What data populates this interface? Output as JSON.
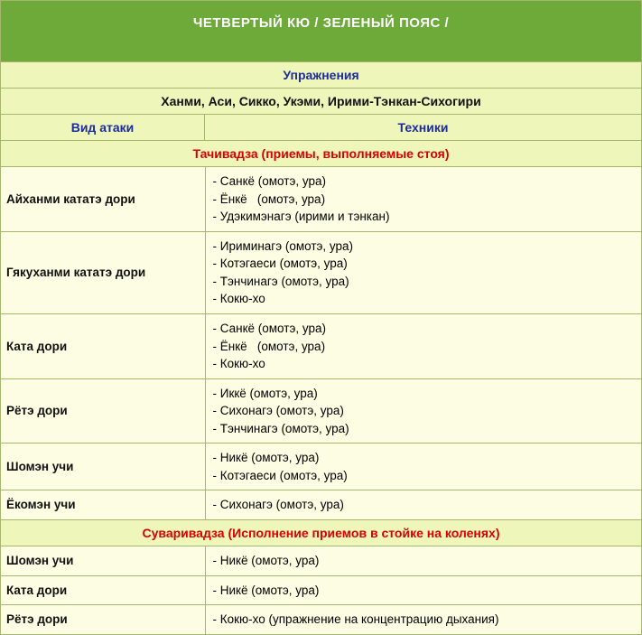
{
  "title": "ЧЕТВЕРТЫЙ КЮ / ЗЕЛЕНЫЙ ПОЯС /",
  "labels": {
    "exercises": "Упражнения",
    "exercises_list": "Ханми, Аси, Сикко, Укэми, Ирими-Тэнкан-Сихогири",
    "attack_kind": "Вид атаки",
    "techniques": "Техники"
  },
  "sections": [
    {
      "header": "Тачивадза (приемы, выполняемые стоя)",
      "rows": [
        {
          "attack": "Айханми кататэ дори",
          "techs": [
            "- Санкё (омотэ, ура)",
            "- Ёнкё   (омотэ, ура)",
            "- Удэкимэнагэ (ирими и тэнкан)"
          ]
        },
        {
          "attack": "Гякуханми кататэ дори",
          "techs": [
            "- Ириминагэ (омотэ, ура)",
            "- Котэгаеси (омотэ, ура)",
            "- Тэнчинагэ (омотэ, ура)",
            "- Кокю-хо"
          ]
        },
        {
          "attack": "Ката дори",
          "techs": [
            "- Санкё (омотэ, ура)",
            "- Ёнкё   (омотэ, ура)",
            "- Кокю-хо"
          ]
        },
        {
          "attack": "Рётэ дори",
          "techs": [
            "- Иккё (омотэ, ура)",
            "- Сихонагэ (омотэ, ура)",
            "- Тэнчинагэ (омотэ, ура)"
          ]
        },
        {
          "attack": "Шомэн учи",
          "techs": [
            "- Никё (омотэ, ура)",
            "- Котэгаеси (омотэ, ура)"
          ]
        },
        {
          "attack": "Ёкомэн учи",
          "techs": [
            "- Сихонагэ (омотэ, ура)"
          ]
        }
      ]
    },
    {
      "header": "Суваривадза  (Исполнение приемов в стойке на коленях)",
      "rows": [
        {
          "attack": "Шомэн учи",
          "techs": [
            "- Никё (омотэ, ура)"
          ]
        },
        {
          "attack": "Ката дори",
          "techs": [
            "- Никё (омотэ, ура)"
          ]
        },
        {
          "attack": "Рётэ дори",
          "techs": [
            "- Кокю-хо (упражнение на концентрацию дыхания)"
          ]
        }
      ]
    }
  ]
}
